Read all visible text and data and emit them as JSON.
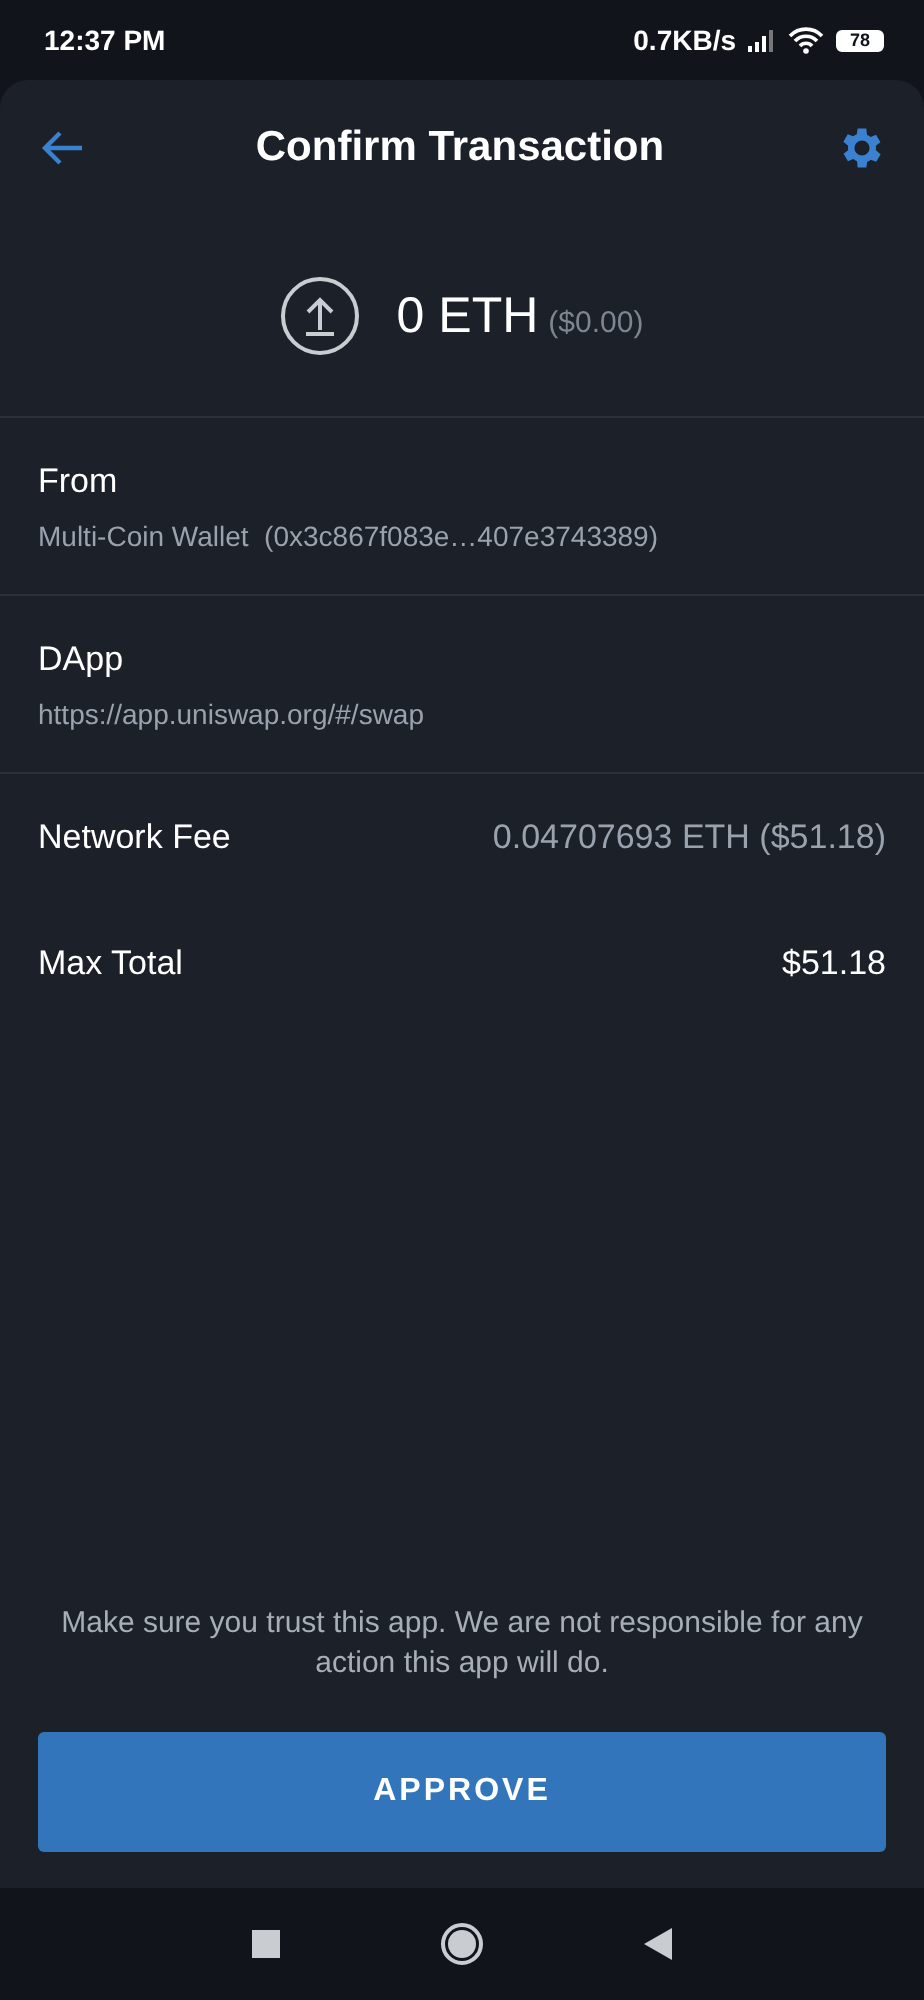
{
  "status_bar": {
    "time": "12:37 PM",
    "speed": "0.7KB/s",
    "battery": "78"
  },
  "header": {
    "title": "Confirm Transaction"
  },
  "amount": {
    "value": "0 ETH",
    "fiat": "($0.00)"
  },
  "sections": [
    {
      "label": "From",
      "value": "Multi-Coin Wallet  (0x3c867f083e…407e3743389)"
    },
    {
      "label": "DApp",
      "value": "https://app.uniswap.org/#/swap"
    }
  ],
  "summary": [
    {
      "label": "Network Fee",
      "value": "0.04707693 ETH ($51.18)",
      "kind": "muted"
    },
    {
      "label": "Max Total",
      "value": "$51.18",
      "kind": "strong"
    }
  ],
  "disclaimer": "Make sure you trust this app. We are not responsible for any action this app will do.",
  "button": "APPROVE"
}
